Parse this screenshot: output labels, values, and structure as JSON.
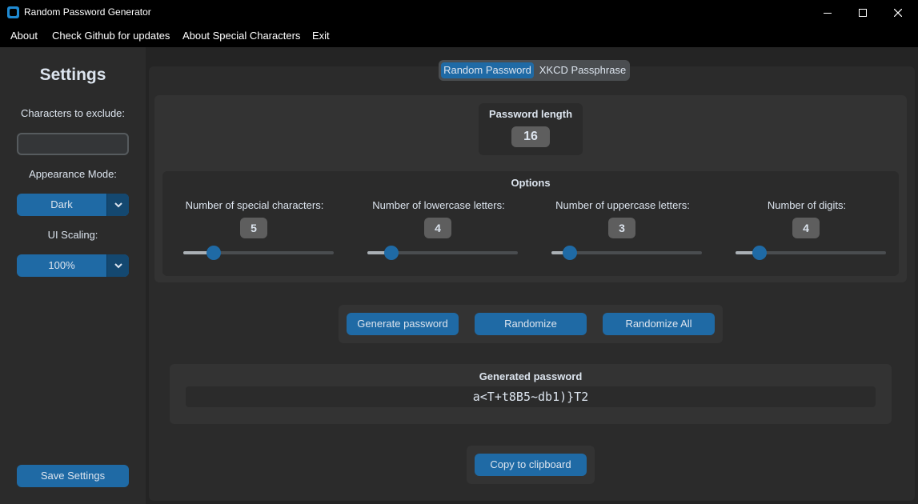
{
  "window": {
    "title": "Random Password Generator"
  },
  "menu": {
    "about": "About",
    "github": "Check Github for updates",
    "special": "About Special Characters",
    "exit": "Exit"
  },
  "sidebar": {
    "title": "Settings",
    "exclude_label": "Characters to exclude:",
    "exclude_value": "",
    "appearance_label": "Appearance Mode:",
    "appearance_value": "Dark",
    "scaling_label": "UI Scaling:",
    "scaling_value": "100%",
    "save_label": "Save Settings"
  },
  "tabs": {
    "active": "Random Password",
    "inactive": "XKCD Passphrase"
  },
  "length": {
    "label": "Password length",
    "value": "16"
  },
  "options": {
    "title": "Options",
    "items": [
      {
        "label": "Number of special characters:",
        "value": "5",
        "level": 0.2
      },
      {
        "label": "Number of lowercase letters:",
        "value": "4",
        "level": 0.16
      },
      {
        "label": "Number of uppercase letters:",
        "value": "3",
        "level": 0.12
      },
      {
        "label": "Number of digits:",
        "value": "4",
        "level": 0.16
      }
    ]
  },
  "actions": {
    "generate": "Generate password",
    "randomize": "Randomize",
    "randomize_all": "Randomize All"
  },
  "output": {
    "label": "Generated password",
    "value": "a<T+t8B5~db1)}T2"
  },
  "copy_label": "Copy to clipboard",
  "colors": {
    "accent": "#1f6aa5",
    "accent_dark": "#144870",
    "background": "#242424",
    "panel": "#2b2b2b"
  }
}
